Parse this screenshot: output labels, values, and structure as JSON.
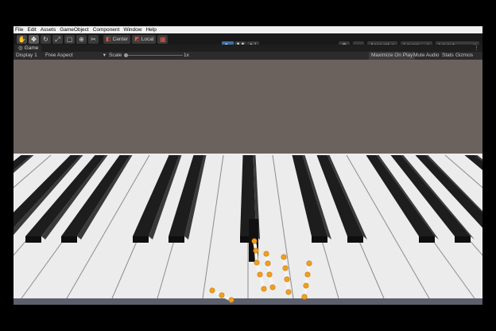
{
  "menu": [
    "File",
    "Edit",
    "Assets",
    "GameObject",
    "Component",
    "Window",
    "Help"
  ],
  "toolbar": {
    "tools": [
      {
        "name": "hand-tool-icon",
        "glyph": "✋"
      },
      {
        "name": "move-tool-icon",
        "glyph": "✥"
      },
      {
        "name": "rotate-tool-icon",
        "glyph": "↻"
      },
      {
        "name": "scale-tool-icon",
        "glyph": "⤢"
      },
      {
        "name": "rect-tool-icon",
        "glyph": "▢"
      },
      {
        "name": "transform-tool-icon",
        "glyph": "⊕"
      },
      {
        "name": "custom-tool-icon",
        "glyph": "✂"
      }
    ],
    "pivot_label": "Center",
    "space_label": "Local",
    "play_glyph": "▶",
    "pause_glyph": "❚❚",
    "step_glyph": "▶|",
    "account_label": "Account",
    "layers_label": "Layers",
    "layout_label": "Layout"
  },
  "game_tab": {
    "title": "Game",
    "display": "Display 1",
    "aspect": "Free Aspect",
    "scale_label": "Scale",
    "scale_value": "1x",
    "maximize": "Maximize On Play",
    "mute": "Mute Audio",
    "stats": "Stats",
    "gizmos": "Gizmos"
  },
  "colors": {
    "sky": "#6b625e",
    "white_key": "#f2f2f2",
    "black_key": "#1d1d1d",
    "play_active": "#3d6fa8",
    "finger_joint": "#f0a020"
  }
}
